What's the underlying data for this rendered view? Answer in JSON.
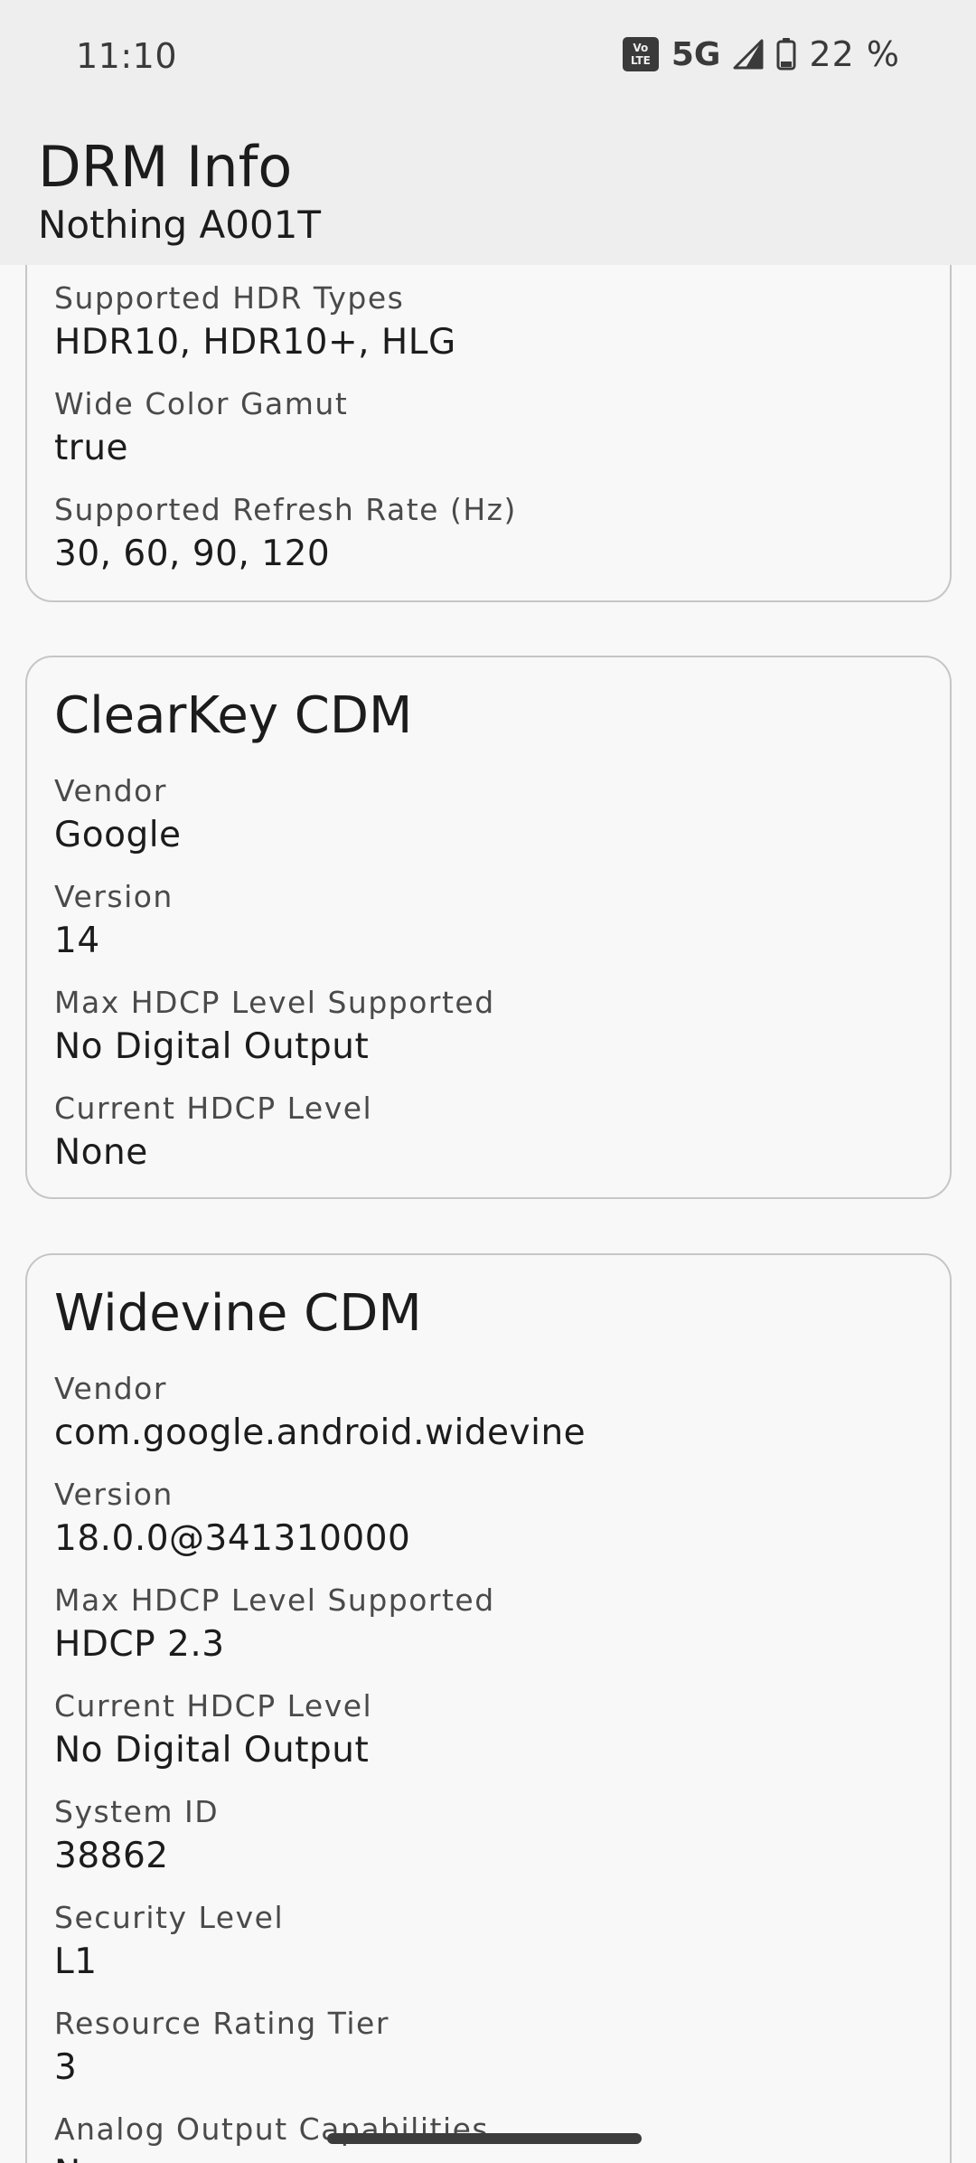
{
  "status_bar": {
    "time": "11:10",
    "volte_top": "Vo",
    "volte_bottom": "LTE",
    "network": "5G",
    "battery": "22 %"
  },
  "app_bar": {
    "title": "DRM Info",
    "subtitle": "Nothing A001T"
  },
  "display_card": {
    "fields": [
      {
        "label": "Supported HDR Types",
        "value": "HDR10, HDR10+, HLG"
      },
      {
        "label": "Wide Color Gamut",
        "value": "true"
      },
      {
        "label": "Supported Refresh Rate (Hz)",
        "value": "30, 60, 90, 120"
      }
    ]
  },
  "clearkey_card": {
    "title": "ClearKey CDM",
    "fields": [
      {
        "label": "Vendor",
        "value": "Google"
      },
      {
        "label": "Version",
        "value": "14"
      },
      {
        "label": "Max HDCP Level Supported",
        "value": "No Digital Output"
      },
      {
        "label": "Current HDCP Level",
        "value": "None"
      }
    ]
  },
  "widevine_card": {
    "title": "Widevine CDM",
    "fields": [
      {
        "label": "Vendor",
        "value": "com.google.android.widevine"
      },
      {
        "label": "Version",
        "value": "18.0.0@341310000"
      },
      {
        "label": "Max HDCP Level Supported",
        "value": "HDCP 2.3"
      },
      {
        "label": "Current HDCP Level",
        "value": "No Digital Output"
      },
      {
        "label": "System ID",
        "value": "38862"
      },
      {
        "label": "Security Level",
        "value": "L1"
      },
      {
        "label": "Resource Rating Tier",
        "value": "3"
      },
      {
        "label": "Analog Output Capabilities",
        "value": "N"
      }
    ]
  }
}
